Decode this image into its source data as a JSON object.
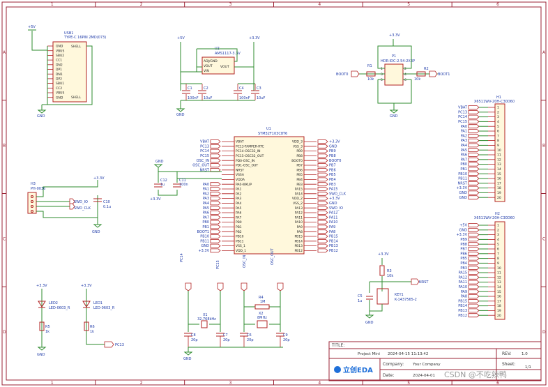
{
  "grid": {
    "columns": [
      "1",
      "2",
      "3",
      "4",
      "5",
      "6"
    ],
    "rows": [
      "A",
      "B",
      "C",
      "D"
    ]
  },
  "nets": {
    "v5": "+5V",
    "v33": "+3.3V",
    "gnd": "GND",
    "boot0": "BOOT0",
    "boot1": "BOOT1",
    "swd_io": "SWD_IO",
    "swd_clk": "SWD_CLK",
    "nrst": "NRST",
    "pc13": "PC13",
    "pc14": "PC14",
    "pc15": "PC15",
    "osc_in": "OSC_IN",
    "osc_out": "OSC_OUT"
  },
  "usb1": {
    "ref": "USB1",
    "value": "TYPE-C 16PIN 2MD(073)",
    "pins": [
      "GND",
      "VBUS",
      "SBU2",
      "CC1",
      "DN2",
      "DP1",
      "DN1",
      "DP2",
      "SBU1",
      "CC2",
      "VBUS",
      "GND"
    ],
    "shell": "SHELL"
  },
  "u2": {
    "ref": "U2",
    "value": "AMS1117-3.3V",
    "pins": [
      "ADJ/GND",
      "VOUT",
      "VIN",
      "VOUT"
    ]
  },
  "caps_power": [
    {
      "ref": "C1",
      "value": "100nF"
    },
    {
      "ref": "C2",
      "value": "10uF"
    },
    {
      "ref": "C4",
      "value": "100nF"
    },
    {
      "ref": "C3",
      "value": "10uF"
    }
  ],
  "p1": {
    "ref": "P1",
    "value": "HDR-IDC-2.54-2X3P",
    "pins": [
      "1",
      "2",
      "3",
      "4",
      "5",
      "6"
    ]
  },
  "r1": {
    "ref": "R1",
    "value": "10k"
  },
  "r2": {
    "ref": "R2",
    "value": "10k"
  },
  "u1": {
    "ref": "U1",
    "value": "STM32F103C8T6",
    "left_pins": [
      "VBAT",
      "PC13-TAMPER-RTC",
      "PC14-OSC32_IN",
      "PC15-OSC32_OUT",
      "PD0-OSC_IN",
      "PD1-OSC_OUT",
      "NRST",
      "VSSA",
      "VDDA",
      "PA0-WKUP",
      "PA1",
      "PA2",
      "PA3",
      "PA4",
      "PA5",
      "PA6",
      "PA7",
      "PB0",
      "PB1",
      "PB2",
      "PB10",
      "PB11",
      "VSS_1",
      "VDD_1"
    ],
    "right_pins": [
      "VDD_3",
      "VSS_3",
      "PB9",
      "PB8",
      "BOOT0",
      "PB7",
      "PB6",
      "PB5",
      "PB4",
      "PB3",
      "PA15",
      "PA14",
      "VDD_2",
      "VSS_2",
      "PA13",
      "PA12",
      "PA11",
      "PA10",
      "PA9",
      "PA8",
      "PB15",
      "PB14",
      "PB13",
      "PB12"
    ],
    "left_nets": [
      "VBAT",
      "PC13",
      "PC14",
      "PC15",
      "OSC_IN",
      "OSC_OUT",
      "NRST",
      "",
      "",
      "PA0",
      "PA1",
      "PA2",
      "PA3",
      "PA4",
      "PA5",
      "PA6",
      "PA7",
      "PB0",
      "PB1",
      "BOOT1",
      "PB10",
      "PB11",
      "GND",
      "+3.3V"
    ],
    "right_nets": [
      "+3.3V",
      "GND",
      "PB9",
      "PB8",
      "BOOT0",
      "PB7",
      "PB6",
      "PB5",
      "PB4",
      "PB3",
      "PA15",
      "SWD_CLK",
      "+3.3V",
      "GND",
      "SWD_IO",
      "PA12",
      "PA11",
      "PA10",
      "PA9",
      "PA8",
      "PB15",
      "PB14",
      "PB13",
      "PB12"
    ]
  },
  "caps_u1": [
    {
      "ref": "C12",
      "value": "1u"
    },
    {
      "ref": "C11",
      "value": "100n"
    }
  ],
  "h3": {
    "ref": "H3",
    "value": "PH-0036"
  },
  "c10": {
    "ref": "C10",
    "value": "0.1u"
  },
  "h1": {
    "ref": "H1",
    "value": "X6511WV-20H-C30D60",
    "nets": [
      "VBAT",
      "PC13",
      "PC14",
      "PC15",
      "PA0",
      "PA1",
      "PA2",
      "PA3",
      "PA4",
      "PA5",
      "PA6",
      "PA7",
      "PB0",
      "PB1",
      "PB10",
      "PB11",
      "NRST",
      "+3.3V",
      "GND",
      "GND"
    ],
    "numbers": [
      "1",
      "2",
      "3",
      "4",
      "5",
      "6",
      "7",
      "8",
      "9",
      "10",
      "11",
      "12",
      "13",
      "14",
      "15",
      "16",
      "17",
      "18",
      "19",
      "20"
    ]
  },
  "h2": {
    "ref": "H2",
    "value": "X6511WV-20H-C30D60",
    "nets": [
      "+5V",
      "GND",
      "+3.3V",
      "PB9",
      "PB8",
      "PB7",
      "PB6",
      "PB5",
      "PB4",
      "PB3",
      "PA15",
      "PA12",
      "PA11",
      "PA10",
      "PA9",
      "PA8",
      "PB15",
      "PB14",
      "PB13",
      "PB12"
    ],
    "numbers": [
      "1",
      "2",
      "3",
      "4",
      "5",
      "6",
      "7",
      "8",
      "9",
      "10",
      "11",
      "12",
      "13",
      "14",
      "15",
      "16",
      "17",
      "18",
      "19",
      "20"
    ]
  },
  "leds": [
    {
      "ref": "LED2",
      "value": "LED-0603_R"
    },
    {
      "ref": "LED1",
      "value": "LED-0603_R"
    }
  ],
  "led_res": [
    {
      "ref": "R5",
      "value": "1k"
    },
    {
      "ref": "R6",
      "value": "1k"
    }
  ],
  "crystals": [
    {
      "ref": "X1",
      "value": "32.768kHz"
    },
    {
      "ref": "X2",
      "value": "8MHz"
    }
  ],
  "r4": {
    "ref": "R4",
    "value": "1M"
  },
  "caps_osc": [
    {
      "ref": "C8",
      "value": "20p"
    },
    {
      "ref": "C7",
      "value": "20p"
    },
    {
      "ref": "C6",
      "value": "20p"
    },
    {
      "ref": "C9",
      "value": "20p"
    }
  ],
  "r3": {
    "ref": "R3",
    "value": "10k"
  },
  "c5": {
    "ref": "C5",
    "value": "1u"
  },
  "key1": {
    "ref": "KEY1",
    "value": "K-1437565-2"
  },
  "title_block": {
    "title_label": "TITLE:",
    "project": "Project Mini",
    "date_time": "2024-04-15  11:13:42",
    "rev_label": "REV:",
    "rev": "1.0",
    "company_label": "Company:",
    "company": "Your Company",
    "sheet_label": "Sheet:",
    "sheet": "1/1",
    "date_label": "Date:",
    "date": "2024-04-01",
    "logo": "立创EDA"
  },
  "watermark": "CSDN @不吃辣鸭"
}
